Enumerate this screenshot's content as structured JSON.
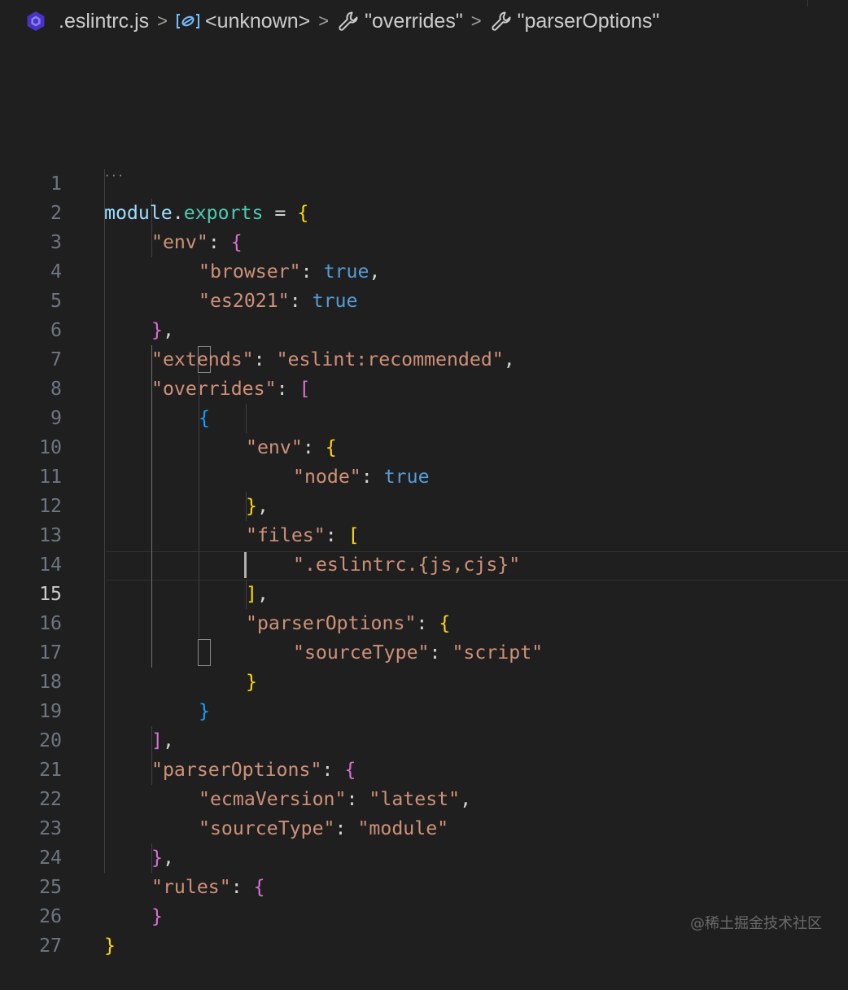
{
  "breadcrumb": {
    "file": ".eslintrc.js",
    "segments": [
      {
        "icon": "object-icon",
        "label": "<unknown>"
      },
      {
        "icon": "wrench-icon",
        "label": "\"overrides\""
      },
      {
        "icon": "wrench-icon",
        "label": "\"parserOptions\""
      }
    ],
    "separator": ">"
  },
  "editor": {
    "active_line": 15,
    "lines": [
      {
        "n": "1"
      },
      {
        "n": "2"
      },
      {
        "n": "3"
      },
      {
        "n": "4"
      },
      {
        "n": "5"
      },
      {
        "n": "6"
      },
      {
        "n": "7"
      },
      {
        "n": "8"
      },
      {
        "n": "9"
      },
      {
        "n": "10"
      },
      {
        "n": "11"
      },
      {
        "n": "12"
      },
      {
        "n": "13"
      },
      {
        "n": "14"
      },
      {
        "n": "15"
      },
      {
        "n": "16"
      },
      {
        "n": "17"
      },
      {
        "n": "18"
      },
      {
        "n": "19"
      },
      {
        "n": "20"
      },
      {
        "n": "21"
      },
      {
        "n": "22"
      },
      {
        "n": "23"
      },
      {
        "n": "24"
      },
      {
        "n": "25"
      },
      {
        "n": "26"
      },
      {
        "n": "27"
      }
    ],
    "tokens": {
      "l1": [
        "module",
        ".",
        "exports",
        " = ",
        "{"
      ],
      "l2": [
        "\"env\"",
        ": ",
        "{"
      ],
      "l3": [
        "\"browser\"",
        ": ",
        "true",
        ","
      ],
      "l4": [
        "\"es2021\"",
        ": ",
        "true"
      ],
      "l5": [
        "}",
        ","
      ],
      "l6": [
        "\"extends\"",
        ": ",
        "\"eslint:recommended\"",
        ","
      ],
      "l7": [
        "\"overrides\"",
        ": ",
        "["
      ],
      "l8": [
        "{"
      ],
      "l9": [
        "\"env\"",
        ": ",
        "{"
      ],
      "l10": [
        "\"node\"",
        ": ",
        "true"
      ],
      "l11": [
        "}",
        ","
      ],
      "l12": [
        "\"files\"",
        ": ",
        "["
      ],
      "l13": [
        "\".eslintrc.{js,cjs}\""
      ],
      "l14": [
        "]",
        ","
      ],
      "l15": [
        "\"parserOptions\"",
        ": ",
        "{"
      ],
      "l16": [
        "\"sourceType\"",
        ": ",
        "\"script\""
      ],
      "l17": [
        "}"
      ],
      "l18": [
        "}"
      ],
      "l19": [
        "]",
        ","
      ],
      "l20": [
        "\"parserOptions\"",
        ": ",
        "{"
      ],
      "l21": [
        "\"ecmaVersion\"",
        ": ",
        "\"latest\"",
        ","
      ],
      "l22": [
        "\"sourceType\"",
        ": ",
        "\"module\""
      ],
      "l23": [
        "}",
        ","
      ],
      "l24": [
        "\"rules\"",
        ": ",
        "{"
      ],
      "l25": [
        "}"
      ],
      "l26": [
        "}"
      ],
      "l27": []
    },
    "hint_dots": "···"
  },
  "watermark": "@稀土掘金技术社区",
  "colors": {
    "background": "#1f1f1f",
    "string": "#ce9178",
    "keyword": "#569cd6",
    "bracket_gold": "#ffd700",
    "bracket_orchid": "#da70d6",
    "bracket_blue": "#179fff"
  }
}
